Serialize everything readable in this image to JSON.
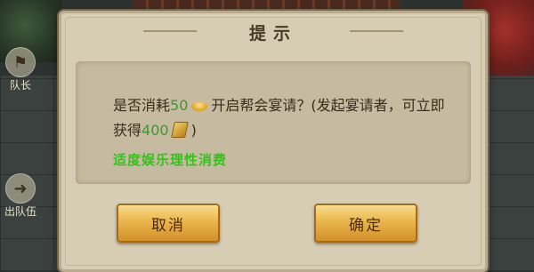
{
  "side_buttons": {
    "leader_label": "队长",
    "quit_label": "出队伍"
  },
  "dialog": {
    "title": "提示",
    "message": {
      "part1": "是否消耗",
      "cost": "50",
      "part2": "开启帮会宴请？(发起宴请者，可立即获得",
      "reward": "400",
      "part3": ")"
    },
    "hint": "适度娱乐理性消费",
    "cancel_label": "取消",
    "confirm_label": "确定"
  },
  "colors": {
    "accent_green": "#36c21c",
    "number_green": "#3c9a2f",
    "button_gold": "#eab64c"
  }
}
